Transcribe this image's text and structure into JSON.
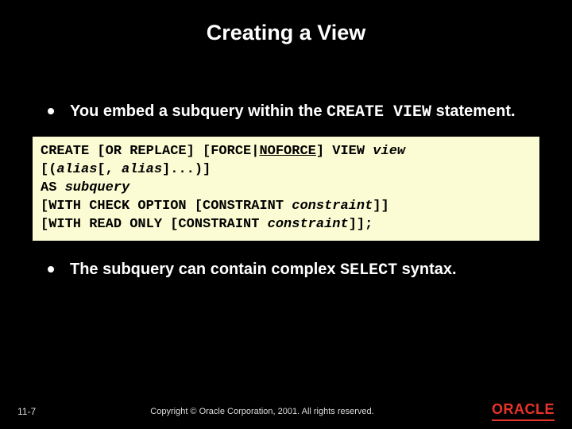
{
  "title": "Creating a View",
  "bullets": [
    {
      "pre": "You embed a subquery within the ",
      "code": "CREATE VIEW",
      "post": " statement."
    },
    {
      "pre": "The subquery can contain complex ",
      "code": "SELECT",
      "post": " syntax."
    }
  ],
  "code": {
    "l1a": "CREATE [OR REPLACE] [FORCE|",
    "l1u": "NOFORCE",
    "l1b": "] VIEW ",
    "l1v": "view",
    "l2a": "  [(",
    "l2i1": "alias",
    "l2b": "[, ",
    "l2i2": "alias",
    "l2c": "]...)]",
    "l3a": " AS ",
    "l3i": "subquery",
    "l4a": "[WITH CHECK OPTION [CONSTRAINT ",
    "l4i": "constraint",
    "l4b": "]]",
    "l5a": "[WITH READ ONLY [CONSTRAINT ",
    "l5i": "constraint",
    "l5b": "]];"
  },
  "footer": {
    "page": "11-7",
    "copyright": "Copyright © Oracle Corporation, 2001. All rights reserved.",
    "logo_text": "ORACLE"
  }
}
